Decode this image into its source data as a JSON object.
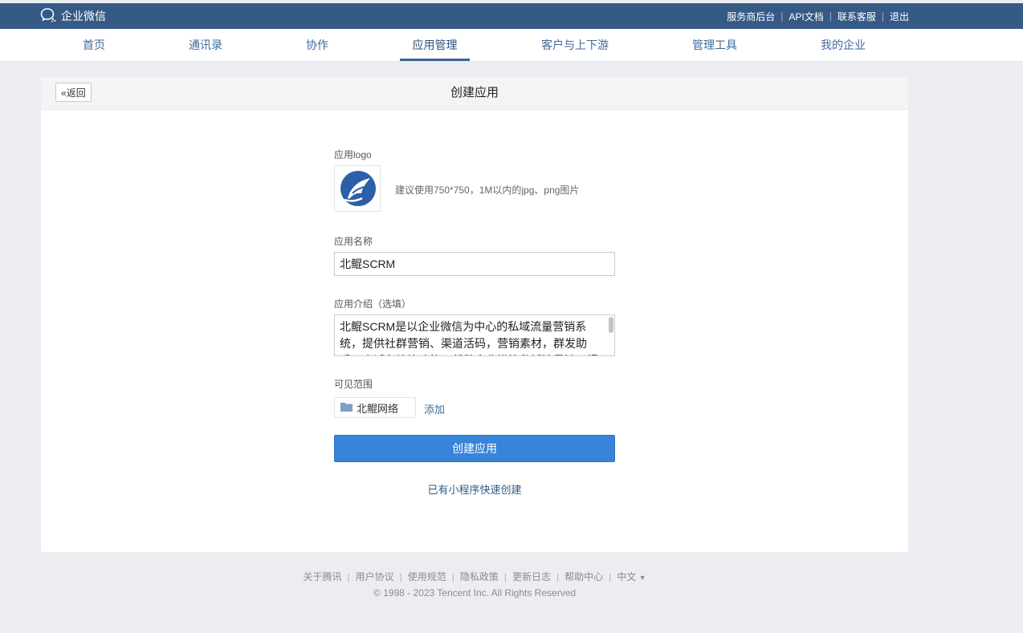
{
  "header": {
    "brand": "企业微信",
    "links": [
      "服务商后台",
      "API文档",
      "联系客服",
      "退出"
    ]
  },
  "nav": {
    "items": [
      "首页",
      "通讯录",
      "协作",
      "应用管理",
      "客户与上下游",
      "管理工具",
      "我的企业"
    ],
    "active": "应用管理"
  },
  "card": {
    "back_label": "返回",
    "title": "创建应用"
  },
  "form": {
    "logo_label": "应用logo",
    "logo_hint": "建议使用750*750，1M以内的jpg、png图片",
    "name_label": "应用名称",
    "name_value": "北鲲SCRM",
    "intro_label": "应用介绍（选填）",
    "intro_value": "北鲲SCRM是以企业微信为中心的私域流量营销系统，提供社群营销、渠道活码，营销素材，群发助手，会话存档等功能，帮助企业搭建私域流量池，提升营销效率。",
    "visible_label": "可见范围",
    "visible_dept": "北鲲网络",
    "add_label": "添加",
    "submit_label": "创建应用",
    "quick_create_label": "已有小程序快速创建"
  },
  "footer": {
    "links": [
      "关于腾讯",
      "用户协议",
      "使用规范",
      "隐私政策",
      "更新日志",
      "帮助中心"
    ],
    "language": "中文",
    "copyright": "© 1998 - 2023 Tencent Inc. All Rights Reserved"
  },
  "colors": {
    "topbar": "#365a86",
    "primary_button": "#3784d8",
    "link": "#3e6a9b",
    "background": "#ebedf0"
  }
}
